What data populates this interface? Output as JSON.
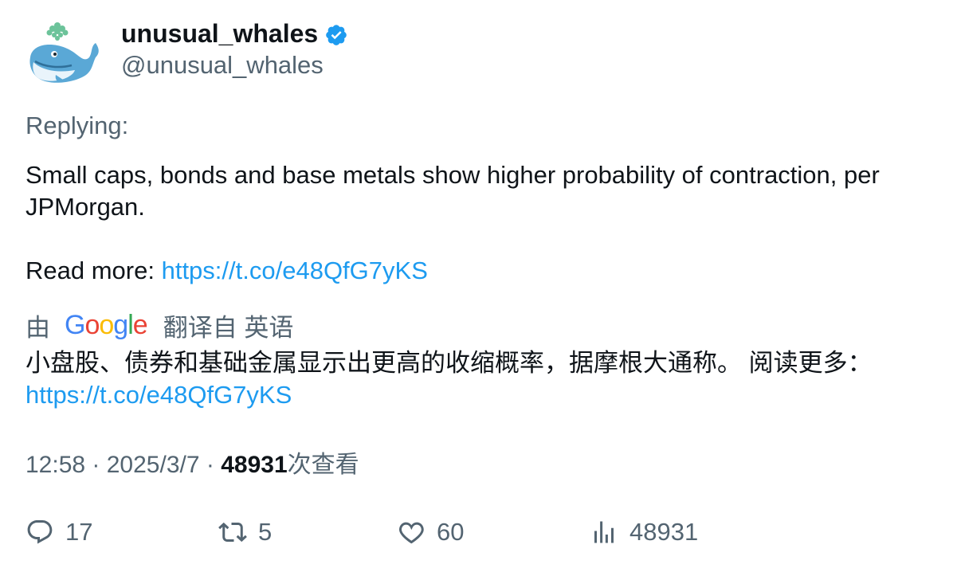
{
  "user": {
    "display_name": "unusual_whales",
    "handle": "@unusual_whales",
    "verified_icon": "verified-badge-icon",
    "avatar": "whale-avatar"
  },
  "replying_label": "Replying:",
  "tweet": {
    "text": "Small caps, bonds and base metals show higher probability of contraction, per JPMorgan.",
    "read_more_label": "Read more:",
    "link": "https://t.co/e48QfG7yKS"
  },
  "translation": {
    "prefix": "由",
    "provider": "Google",
    "suffix": "翻译自 英语",
    "text": "小盘股、债券和基础金属显示出更高的收缩概率，据摩根大通称。 阅读更多：",
    "link": "https://t.co/e48QfG7yKS"
  },
  "meta": {
    "time": "12:58",
    "separator": " · ",
    "date": "2025/3/7",
    "views_count": "48931",
    "views_label": "次查看"
  },
  "actions": {
    "replies": "17",
    "retweets": "5",
    "likes": "60",
    "views": "48931"
  },
  "colors": {
    "link": "#1d9bf0",
    "secondary_text": "#536471",
    "primary_text": "#0f1419",
    "verified": "#1d9bf0"
  }
}
